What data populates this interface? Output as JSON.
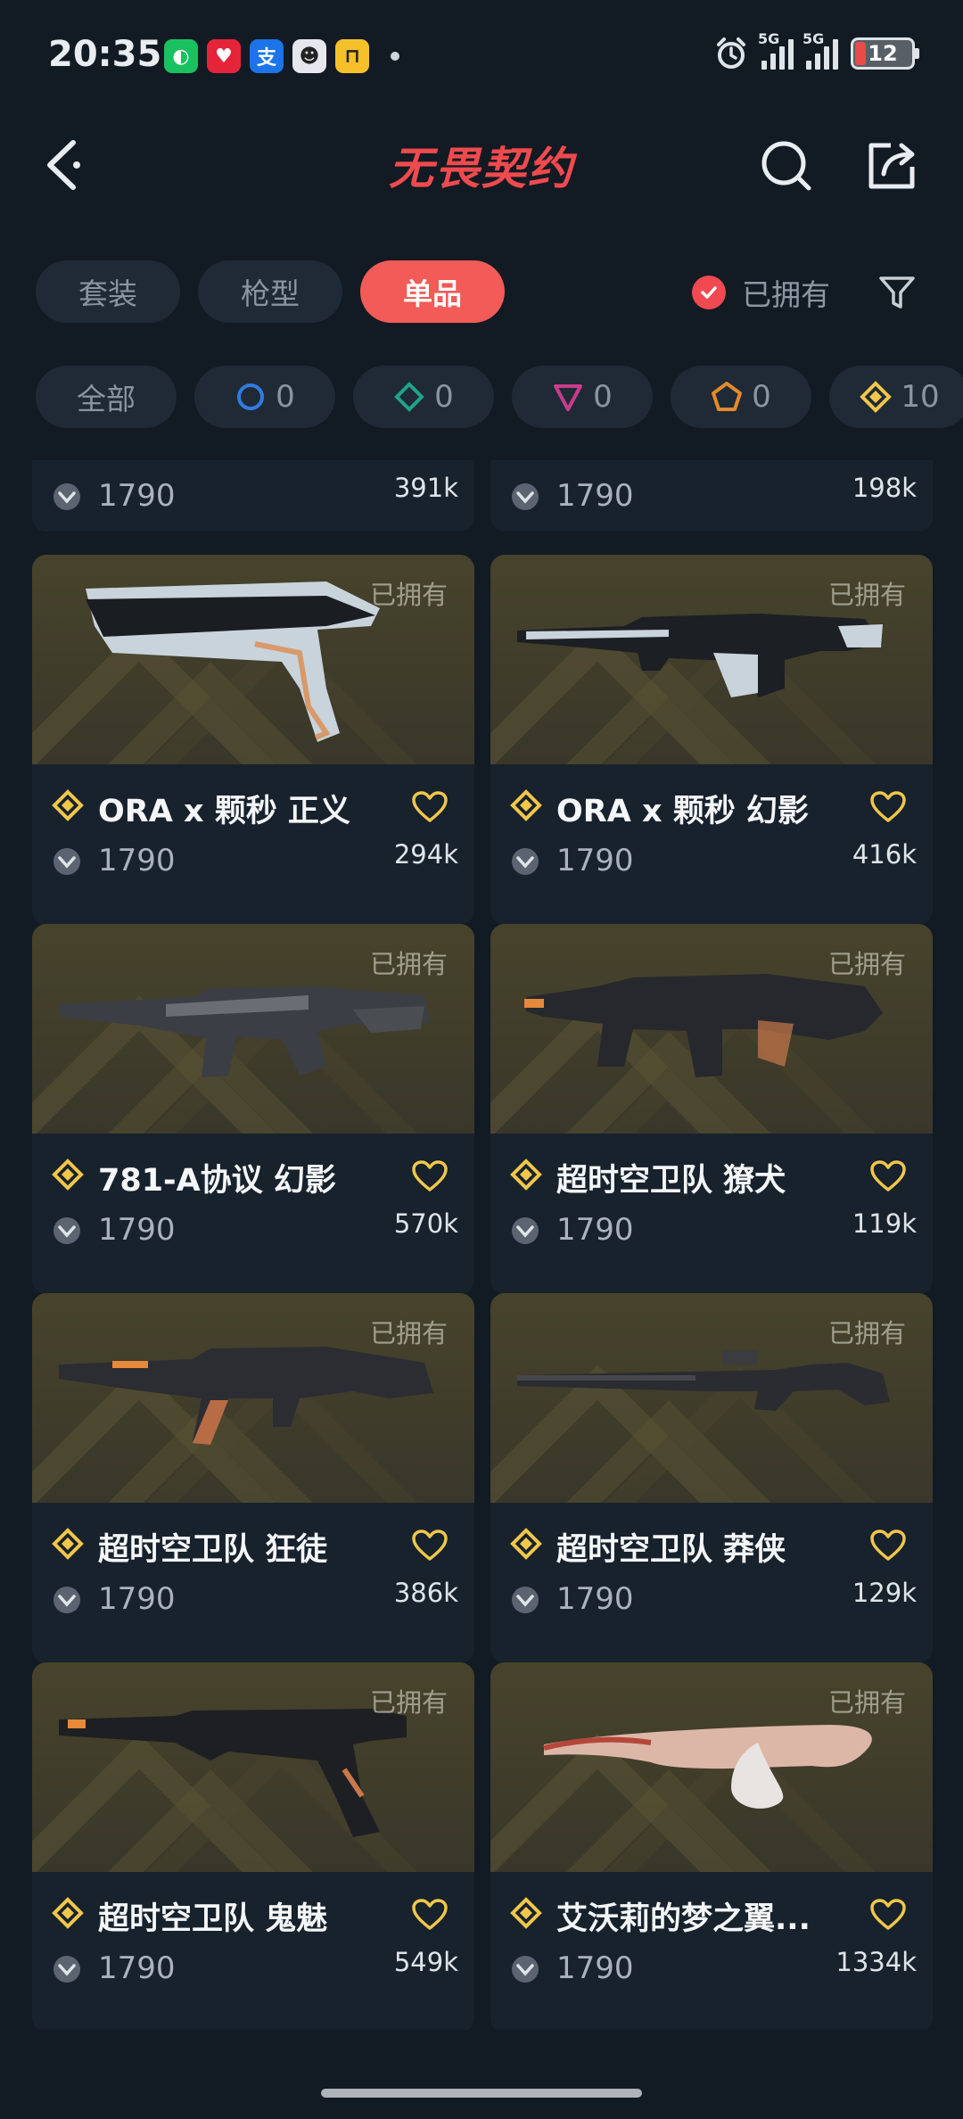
{
  "status_bar": {
    "time": "20:35",
    "apps": [
      {
        "icon": "wechat-icon",
        "color": "#19c160",
        "glyph": "◐"
      },
      {
        "icon": "heart-app-icon",
        "color": "#e5243a",
        "glyph": "♥"
      },
      {
        "icon": "alipay-icon",
        "color": "#1c74e8",
        "glyph": "支"
      },
      {
        "icon": "game-app-icon",
        "color": "#e6e6ee",
        "glyph": "☻"
      },
      {
        "icon": "car-app-icon",
        "color": "#f5c02a",
        "glyph": "⊓"
      }
    ],
    "signal1_label": "5G",
    "signal2_label": "5G",
    "battery": "12"
  },
  "header": {
    "title": "无畏契约"
  },
  "tabs": [
    {
      "label": "套装",
      "active": false
    },
    {
      "label": "枪型",
      "active": false
    },
    {
      "label": "单品",
      "active": true
    }
  ],
  "owned_filter": {
    "label": "已拥有",
    "checked": true
  },
  "rarity_chips": [
    {
      "label": "全部",
      "icon": null,
      "count": null
    },
    {
      "label": "",
      "icon": "select-tier-icon",
      "color": "#2f7de0",
      "count": "0"
    },
    {
      "label": "",
      "icon": "deluxe-tier-icon",
      "color": "#1fa38a",
      "count": "0"
    },
    {
      "label": "",
      "icon": "premium-tier-icon",
      "color": "#c93c8b",
      "count": "0"
    },
    {
      "label": "",
      "icon": "exclusive-tier-icon",
      "color": "#e48a2b",
      "count": "0"
    },
    {
      "label": "",
      "icon": "ultra-tier-icon",
      "color": "#f1c74a",
      "count": "10"
    }
  ],
  "partial_cards": [
    {
      "price": "1790",
      "likes": "391k"
    },
    {
      "price": "1790",
      "likes": "198k"
    }
  ],
  "cards": [
    {
      "name": "ORA x 颗秒 正义",
      "price": "1790",
      "likes": "294k",
      "owned": "已拥有",
      "weapon": "pistol-light"
    },
    {
      "name": "ORA x 颗秒 幻影",
      "price": "1790",
      "likes": "416k",
      "owned": "已拥有",
      "weapon": "rifle-light"
    },
    {
      "name": "781-A协议 幻影",
      "price": "1790",
      "likes": "570k",
      "owned": "已拥有",
      "weapon": "rifle-dark"
    },
    {
      "name": "超时空卫队 獠犬",
      "price": "1790",
      "likes": "119k",
      "owned": "已拥有",
      "weapon": "smg-dark"
    },
    {
      "name": "超时空卫队 狂徒",
      "price": "1790",
      "likes": "386k",
      "owned": "已拥有",
      "weapon": "ak-dark"
    },
    {
      "name": "超时空卫队 莽侠",
      "price": "1790",
      "likes": "129k",
      "owned": "已拥有",
      "weapon": "sniper-dark"
    },
    {
      "name": "超时空卫队 鬼魅",
      "price": "1790",
      "likes": "549k",
      "owned": "已拥有",
      "weapon": "pistol-dark"
    },
    {
      "name": "艾沃莉的梦之翼...",
      "price": "1790",
      "likes": "1334k",
      "owned": "已拥有",
      "weapon": "knife"
    }
  ]
}
